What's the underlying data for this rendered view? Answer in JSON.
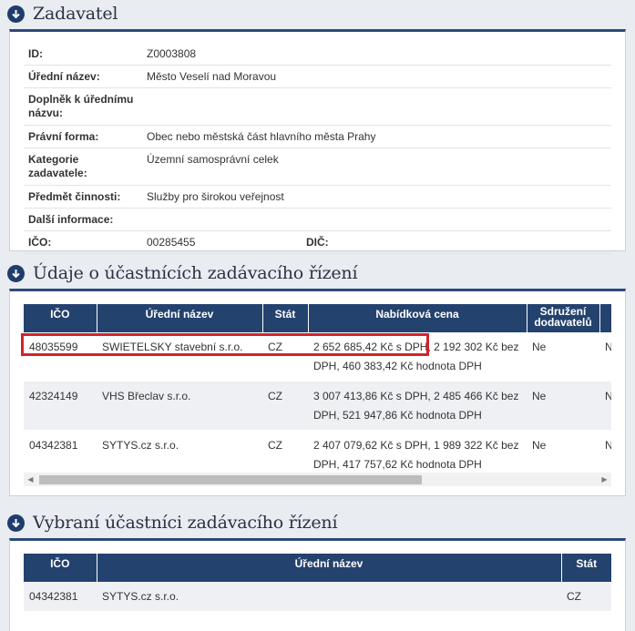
{
  "zadavatel": {
    "title": "Zadavatel",
    "rows": [
      {
        "label": "ID:",
        "value": "Z0003808"
      },
      {
        "label": "Úřední název:",
        "value": "Město Veselí nad Moravou"
      },
      {
        "label": "Doplněk k úřednímu názvu:",
        "value": ""
      },
      {
        "label": "Právní forma:",
        "value": "Obec nebo městská část hlavního města Prahy"
      },
      {
        "label": "Kategorie zadavatele:",
        "value": "Územní samosprávní celek"
      },
      {
        "label": "Předmět činnosti:",
        "value": "Služby pro širokou veřejnost"
      },
      {
        "label": "Další informace:",
        "value": ""
      }
    ],
    "ico_label": "IČO:",
    "ico_value": "00285455",
    "dic_label": "DIČ:"
  },
  "ucastnici": {
    "title": "Údaje o účastnících zadávacího řízení",
    "headers": [
      "IČO",
      "Úřední název",
      "Stát",
      "Nabídková cena",
      "Sdružení dodavatelů"
    ],
    "rows": [
      {
        "ico": "48035599",
        "nazev": "SWIETELSKY stavební s.r.o.",
        "stat": "CZ",
        "cena": "2 652 685,42 Kč s DPH, 2 192 302 Kč bez DPH, 460 383,42 Kč hodnota DPH",
        "sdruzeni": "Ne",
        "extra": "N"
      },
      {
        "ico": "42324149",
        "nazev": "VHS Břeclav s.r.o.",
        "stat": "CZ",
        "cena": "3 007 413,86 Kč s DPH, 2 485 466 Kč bez DPH, 521 947,86 Kč hodnota DPH",
        "sdruzeni": "Ne",
        "extra": "N"
      },
      {
        "ico": "04342381",
        "nazev": "SYTYS.cz s.r.o.",
        "stat": "CZ",
        "cena": "2 407 079,62 Kč s DPH, 1 989 322 Kč bez DPH, 417 757,62 Kč hodnota DPH",
        "sdruzeni": "Ne",
        "extra": "N"
      }
    ]
  },
  "vybrani": {
    "title": "Vybraní účastníci zadávacího řízení",
    "headers": [
      "IČO",
      "Úřední název",
      "Stát"
    ],
    "rows": [
      {
        "ico": "04342381",
        "nazev": "SYTYS.cz s.r.o.",
        "stat": "CZ"
      }
    ]
  },
  "colors": {
    "header_bg": "#24426e",
    "accent": "#2d4a78",
    "highlight": "#d52228"
  },
  "icons": {
    "section": "arrow-down-circle-icon",
    "scroll_left": "scroll-left-arrow-icon",
    "scroll_right": "scroll-right-arrow-icon"
  }
}
